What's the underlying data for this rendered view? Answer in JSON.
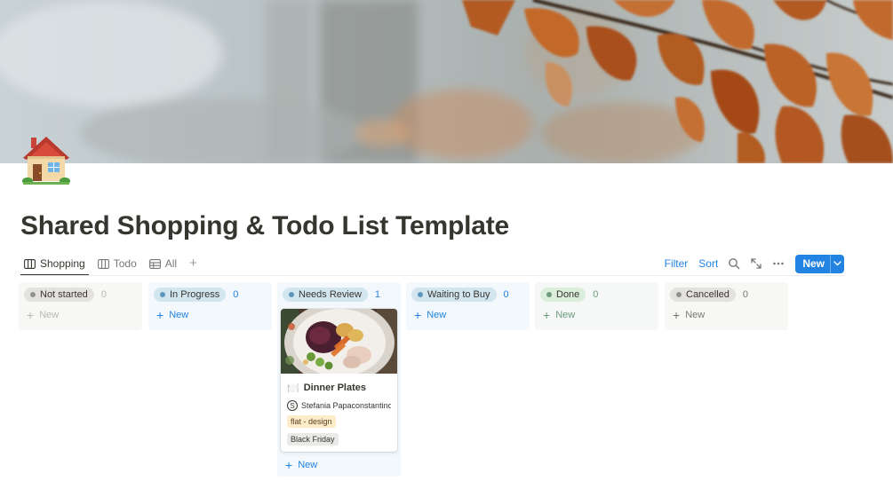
{
  "page": {
    "title": "Shared Shopping & Todo List Template",
    "icon": "house-icon"
  },
  "tabs": [
    {
      "label": "Shopping",
      "icon": "board-icon",
      "active": true
    },
    {
      "label": "Todo",
      "icon": "board-icon",
      "active": false
    },
    {
      "label": "All",
      "icon": "table-icon",
      "active": false
    }
  ],
  "toolbar": {
    "filter_label": "Filter",
    "sort_label": "Sort",
    "new_label": "New",
    "icons": [
      "search-icon",
      "expand-icon",
      "more-icon",
      "chevron-down-icon"
    ]
  },
  "columns": [
    {
      "status": "Not started",
      "count": "0",
      "new_label": "New",
      "bg": "#f7f7f5",
      "pill": "#e3e2e0",
      "dot": "#91918e",
      "accent": "#b9b8b5"
    },
    {
      "status": "In Progress",
      "count": "0",
      "new_label": "New",
      "bg": "#f3f8fc",
      "pill": "#d3e5ef",
      "dot": "#5b97bd",
      "accent": "#2383e2"
    },
    {
      "status": "Needs Review",
      "count": "1",
      "new_label": "New",
      "bg": "#f3f8fc",
      "pill": "#d3e5ef",
      "dot": "#5b97bd",
      "accent": "#2383e2"
    },
    {
      "status": "Waiting to Buy",
      "count": "0",
      "new_label": "New",
      "bg": "#f3f8fc",
      "pill": "#d3e5ef",
      "dot": "#5b97bd",
      "accent": "#2383e2"
    },
    {
      "status": "Done",
      "count": "0",
      "new_label": "New",
      "bg": "#f5f8f6",
      "pill": "#dbeddb",
      "dot": "#6c9b7d",
      "accent": "#6c9b7d"
    },
    {
      "status": "Cancelled",
      "count": "0",
      "new_label": "New",
      "bg": "#f7f7f5",
      "pill": "#e3e2e0",
      "dot": "#91918e",
      "accent": "#787774"
    }
  ],
  "card": {
    "emoji": "🍽️",
    "title": "Dinner Plates",
    "person_initial": "S",
    "person": "Stefania Papaconstantinou",
    "tags": [
      "flat - design",
      "Black Friday"
    ]
  }
}
